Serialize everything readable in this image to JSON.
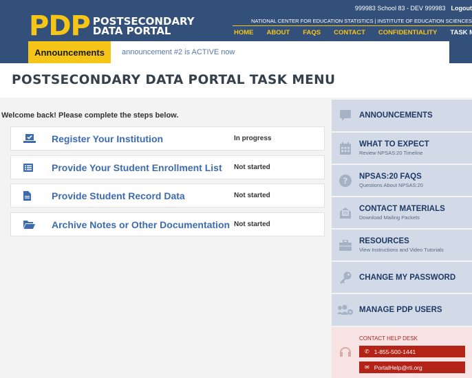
{
  "header": {
    "logo_mark": "PDP",
    "logo_line1": "POSTSECONDARY",
    "logo_line2": "DATA PORTAL",
    "user_school": "999983 School 83 - DEV 999983",
    "logout": "Logout",
    "nces_line": "NATIONAL CENTER FOR EDUCATION STATISTICS  |  INSTITUTE OF EDUCATION SCIENCES",
    "nav": [
      "HOME",
      "ABOUT",
      "FAQS",
      "CONTACT",
      "CONFIDENTIALITY",
      "TASK MENU"
    ]
  },
  "announcement": {
    "tag": "Announcements",
    "message": "announcement #2 is ACTIVE now"
  },
  "page_title": "POSTSECONDARY DATA PORTAL TASK MENU",
  "welcome": "Welcome back! Please complete the steps below.",
  "tasks": [
    {
      "icon": "laptop-check-icon",
      "label": "Register Your Institution",
      "status": "In progress"
    },
    {
      "icon": "list-icon",
      "label": "Provide Your Student Enrollment List",
      "status": "Not started"
    },
    {
      "icon": "document-icon",
      "label": "Provide Student Record Data",
      "status": "Not started"
    },
    {
      "icon": "folder-open-icon",
      "label": "Archive Notes or Other Documentation",
      "status": "Not started"
    }
  ],
  "sidebar": [
    {
      "icon": "chat-bubble-icon",
      "title": "ANNOUNCEMENTS",
      "subtitle": ""
    },
    {
      "icon": "calendar-icon",
      "title": "WHAT TO EXPECT",
      "subtitle": "Review NPSAS:20 Timeline"
    },
    {
      "icon": "question-icon",
      "title": "NPSAS:20 FAQS",
      "subtitle": "Questions About NPSAS:20"
    },
    {
      "icon": "envelope-icon",
      "title": "CONTACT MATERIALS",
      "subtitle": "Download Mailing Packets"
    },
    {
      "icon": "briefcase-icon",
      "title": "RESOURCES",
      "subtitle": "View Instructions and Video Tutorials"
    },
    {
      "icon": "key-icon",
      "title": "CHANGE MY PASSWORD",
      "subtitle": ""
    },
    {
      "icon": "users-gear-icon",
      "title": "MANAGE PDP USERS",
      "subtitle": ""
    }
  ],
  "help": {
    "title": "CONTACT HELP DESK",
    "phone": "1-855-500-1441",
    "email": "PortalHelp@rti.org"
  },
  "colors": {
    "header_navy": "#33507a",
    "brand_yellow": "#f5c518",
    "link_blue": "#3d6bb0",
    "sidebar_bg": "#d2dae7",
    "help_red": "#b42318"
  }
}
